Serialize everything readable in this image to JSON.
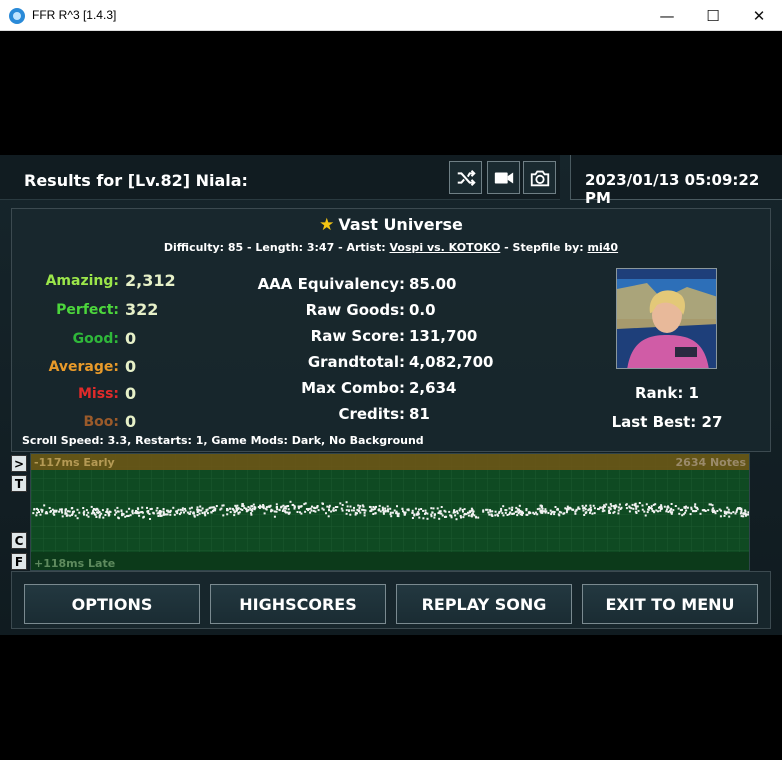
{
  "window": {
    "title": "FFR R^3 [1.4.3]",
    "min_glyph": "—",
    "max_glyph": "☐",
    "close_glyph": "✕"
  },
  "header": {
    "results_title": "Results for [Lv.82] Niala:",
    "datetime": "2023/01/13 05:09:22 PM",
    "icons": [
      "shuffle-icon",
      "video-camera-icon",
      "camera-icon"
    ]
  },
  "song": {
    "title": "Vast Universe",
    "difficulty_prefix": "Difficulty: 85 - Length: 3:47 - Artist: ",
    "artist": "Vospi vs. KOTOKO",
    "stepfile_prefix": " - Stepfile by: ",
    "stepfile_author": "mi40"
  },
  "judgements": [
    {
      "label": "Amazing:",
      "value": "2,312",
      "color": "#9be64a"
    },
    {
      "label": "Perfect:",
      "value": "322",
      "color": "#4cd63c"
    },
    {
      "label": "Good:",
      "value": "0",
      "color": "#2fb83a"
    },
    {
      "label": "Average:",
      "value": "0",
      "color": "#e89a2a"
    },
    {
      "label": "Miss:",
      "value": "0",
      "color": "#e02a2a"
    },
    {
      "label": "Boo:",
      "value": "0",
      "color": "#9a5a2a"
    }
  ],
  "stats": [
    {
      "label": "AAA Equivalency:",
      "value": "85.00"
    },
    {
      "label": "Raw Goods:",
      "value": "0.0"
    },
    {
      "label": "Raw Score:",
      "value": "131,700"
    },
    {
      "label": "Grandtotal:",
      "value": "4,082,700"
    },
    {
      "label": "Max Combo:",
      "value": "2,634"
    },
    {
      "label": "Credits:",
      "value": "81"
    }
  ],
  "rank": {
    "rank_text": "Rank: 1",
    "last_best_text": "Last Best: 27"
  },
  "info_line": "Scroll Speed: 3.3, Restarts: 1, Game Mods: Dark, No Background",
  "graph": {
    "early_label": "-117ms Early",
    "late_label": "+118ms Late",
    "notes_label": "2634 Notes",
    "side_buttons": [
      ">",
      "T",
      "C",
      "F"
    ]
  },
  "buttons": [
    "OPTIONS",
    "HIGHSCORES",
    "REPLAY SONG",
    "EXIT TO MENU"
  ],
  "colors": {
    "early_band": "#6b5516",
    "graph_bg": "#0f3d1e",
    "accent_star": "#f3c514"
  }
}
